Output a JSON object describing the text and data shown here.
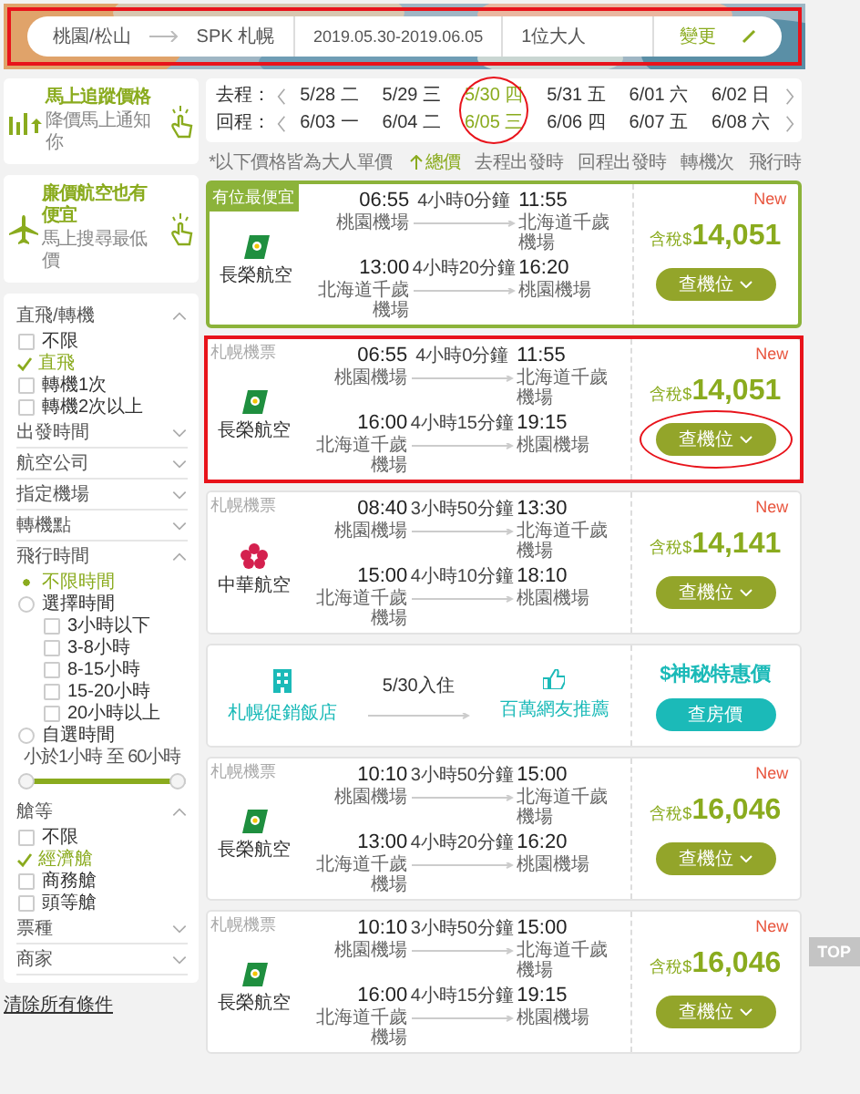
{
  "search_bar": {
    "origin": "桃園/松山",
    "destination": "SPK 札幌",
    "dates": "2019.05.30-2019.06.05",
    "travelers": "1位大人",
    "change_button": "變更",
    "annotated": true
  },
  "price_alert": {
    "title": "馬上追蹤價格",
    "subtitle": "降價馬上通知你"
  },
  "lcc_promo": {
    "title": "廉價航空也有便宜",
    "subtitle": "馬上搜尋最低價"
  },
  "filters": {
    "sections": [
      {
        "title": "直飛/轉機",
        "expanded": true,
        "options": [
          {
            "kind": "checkbox",
            "label": "不限",
            "checked": false
          },
          {
            "kind": "checkbox",
            "label": "直飛",
            "checked": true
          },
          {
            "kind": "checkbox",
            "label": "轉機1次",
            "checked": false
          },
          {
            "kind": "checkbox",
            "label": "轉機2次以上",
            "checked": false
          }
        ]
      },
      {
        "title": "出發時間",
        "expanded": false
      },
      {
        "title": "航空公司",
        "expanded": false
      },
      {
        "title": "指定機場",
        "expanded": false
      },
      {
        "title": "轉機點",
        "expanded": false
      },
      {
        "title": "飛行時間",
        "expanded": true,
        "options": [
          {
            "kind": "radio",
            "label": "不限時間",
            "selected": true
          },
          {
            "kind": "radio",
            "label": "選擇時間",
            "selected": false,
            "children": [
              {
                "kind": "checkbox",
                "label": "3小時以下",
                "checked": false
              },
              {
                "kind": "checkbox",
                "label": "3-8小時",
                "checked": false
              },
              {
                "kind": "checkbox",
                "label": "8-15小時",
                "checked": false
              },
              {
                "kind": "checkbox",
                "label": "15-20小時",
                "checked": false
              },
              {
                "kind": "checkbox",
                "label": "20小時以上",
                "checked": false
              }
            ]
          },
          {
            "kind": "radio",
            "label": "自選時間",
            "selected": false
          },
          {
            "kind": "range",
            "label": "小於1小時 至 60小時",
            "level": 1
          }
        ]
      },
      {
        "title": "艙等",
        "expanded": true,
        "options": [
          {
            "kind": "checkbox",
            "label": "不限",
            "checked": false
          },
          {
            "kind": "checkbox",
            "label": "經濟艙",
            "checked": true
          },
          {
            "kind": "checkbox",
            "label": "商務艙",
            "checked": false
          },
          {
            "kind": "checkbox",
            "label": "頭等艙",
            "checked": false
          }
        ]
      },
      {
        "title": "票種",
        "expanded": false
      },
      {
        "title": "商家",
        "expanded": false
      }
    ],
    "clear_link": "清除所有條件"
  },
  "dates": {
    "outbound_label": "去程：",
    "return_label": "回程：",
    "annotated": true,
    "columns": [
      {
        "outbound": "5/28 二",
        "return": "6/03 一",
        "selected": false
      },
      {
        "outbound": "5/29 三",
        "return": "6/04 二",
        "selected": false
      },
      {
        "outbound": "5/30 四",
        "return": "6/05 三",
        "selected": true
      },
      {
        "outbound": "5/31 五",
        "return": "6/06 四",
        "selected": false
      },
      {
        "outbound": "6/01 六",
        "return": "6/07 五",
        "selected": false
      },
      {
        "outbound": "6/02 日",
        "return": "6/08 六",
        "selected": false
      }
    ]
  },
  "sort_bar": {
    "note": "*以下價格皆為大人單價",
    "options": [
      {
        "label": "總價",
        "selected": true
      },
      {
        "label": "去程出發時",
        "selected": false
      },
      {
        "label": "回程出發時",
        "selected": false
      },
      {
        "label": "轉機次",
        "selected": false
      },
      {
        "label": "飛行時",
        "selected": false
      }
    ]
  },
  "results": [
    {
      "kind": "flight",
      "tag": "有位最便宜",
      "featured": true,
      "annotated": false,
      "airline": "長榮航空",
      "logo": {
        "kind": "tail",
        "color": "#1f8f3f"
      },
      "badge": "New",
      "price_prefix": "含稅$",
      "price": "14,051",
      "button": "查機位",
      "legs": [
        {
          "depart_time": "06:55",
          "duration": "4小時0分鐘",
          "arrive_time": "11:55",
          "depart_airport": "桃園機場",
          "arrive_airport": "北海道千歲機場"
        },
        {
          "depart_time": "13:00",
          "duration": "4小時20分鐘",
          "arrive_time": "16:20",
          "depart_airport": "北海道千歲機場",
          "arrive_airport": "桃園機場"
        }
      ]
    },
    {
      "kind": "flight",
      "tag": "札幌機票",
      "featured": false,
      "annotated": true,
      "airline": "長榮航空",
      "logo": {
        "kind": "tail",
        "color": "#1f8f3f"
      },
      "badge": "New",
      "price_prefix": "含稅$",
      "price": "14,051",
      "button": "查機位",
      "legs": [
        {
          "depart_time": "06:55",
          "duration": "4小時0分鐘",
          "arrive_time": "11:55",
          "depart_airport": "桃園機場",
          "arrive_airport": "北海道千歲機場"
        },
        {
          "depart_time": "16:00",
          "duration": "4小時15分鐘",
          "arrive_time": "19:15",
          "depart_airport": "北海道千歲機場",
          "arrive_airport": "桃園機場"
        }
      ]
    },
    {
      "kind": "flight",
      "tag": "札幌機票",
      "featured": false,
      "annotated": false,
      "airline": "中華航空",
      "logo": {
        "kind": "flower",
        "color": "#d4204e"
      },
      "badge": "New",
      "price_prefix": "含稅$",
      "price": "14,141",
      "button": "查機位",
      "legs": [
        {
          "depart_time": "08:40",
          "duration": "3小時50分鐘",
          "arrive_time": "13:30",
          "depart_airport": "桃園機場",
          "arrive_airport": "北海道千歲機場"
        },
        {
          "depart_time": "15:00",
          "duration": "4小時10分鐘",
          "arrive_time": "18:10",
          "depart_airport": "北海道千歲機場",
          "arrive_airport": "桃園機場"
        }
      ]
    },
    {
      "kind": "hotel",
      "hotel": "札幌促銷飯店",
      "checkin": "5/30入住",
      "recommend": "百萬網友推薦",
      "price": "$神秘特惠價",
      "button": "查房價"
    },
    {
      "kind": "flight",
      "tag": "札幌機票",
      "featured": false,
      "annotated": false,
      "airline": "長榮航空",
      "logo": {
        "kind": "tail",
        "color": "#1f8f3f"
      },
      "badge": "New",
      "price_prefix": "含稅$",
      "price": "16,046",
      "button": "查機位",
      "legs": [
        {
          "depart_time": "10:10",
          "duration": "3小時50分鐘",
          "arrive_time": "15:00",
          "depart_airport": "桃園機場",
          "arrive_airport": "北海道千歲機場"
        },
        {
          "depart_time": "13:00",
          "duration": "4小時20分鐘",
          "arrive_time": "16:20",
          "depart_airport": "北海道千歲機場",
          "arrive_airport": "桃園機場"
        }
      ]
    },
    {
      "kind": "flight",
      "tag": "札幌機票",
      "featured": false,
      "annotated": false,
      "airline": "長榮航空",
      "logo": {
        "kind": "tail",
        "color": "#1f8f3f"
      },
      "badge": "New",
      "price_prefix": "含稅$",
      "price": "16,046",
      "button": "查機位",
      "legs": [
        {
          "depart_time": "10:10",
          "duration": "3小時50分鐘",
          "arrive_time": "15:00",
          "depart_airport": "桃園機場",
          "arrive_airport": "北海道千歲機場"
        },
        {
          "depart_time": "16:00",
          "duration": "4小時15分鐘",
          "arrive_time": "19:15",
          "depart_airport": "北海道千歲機場",
          "arrive_airport": "桃園機場"
        }
      ]
    }
  ],
  "top_button": "TOP"
}
